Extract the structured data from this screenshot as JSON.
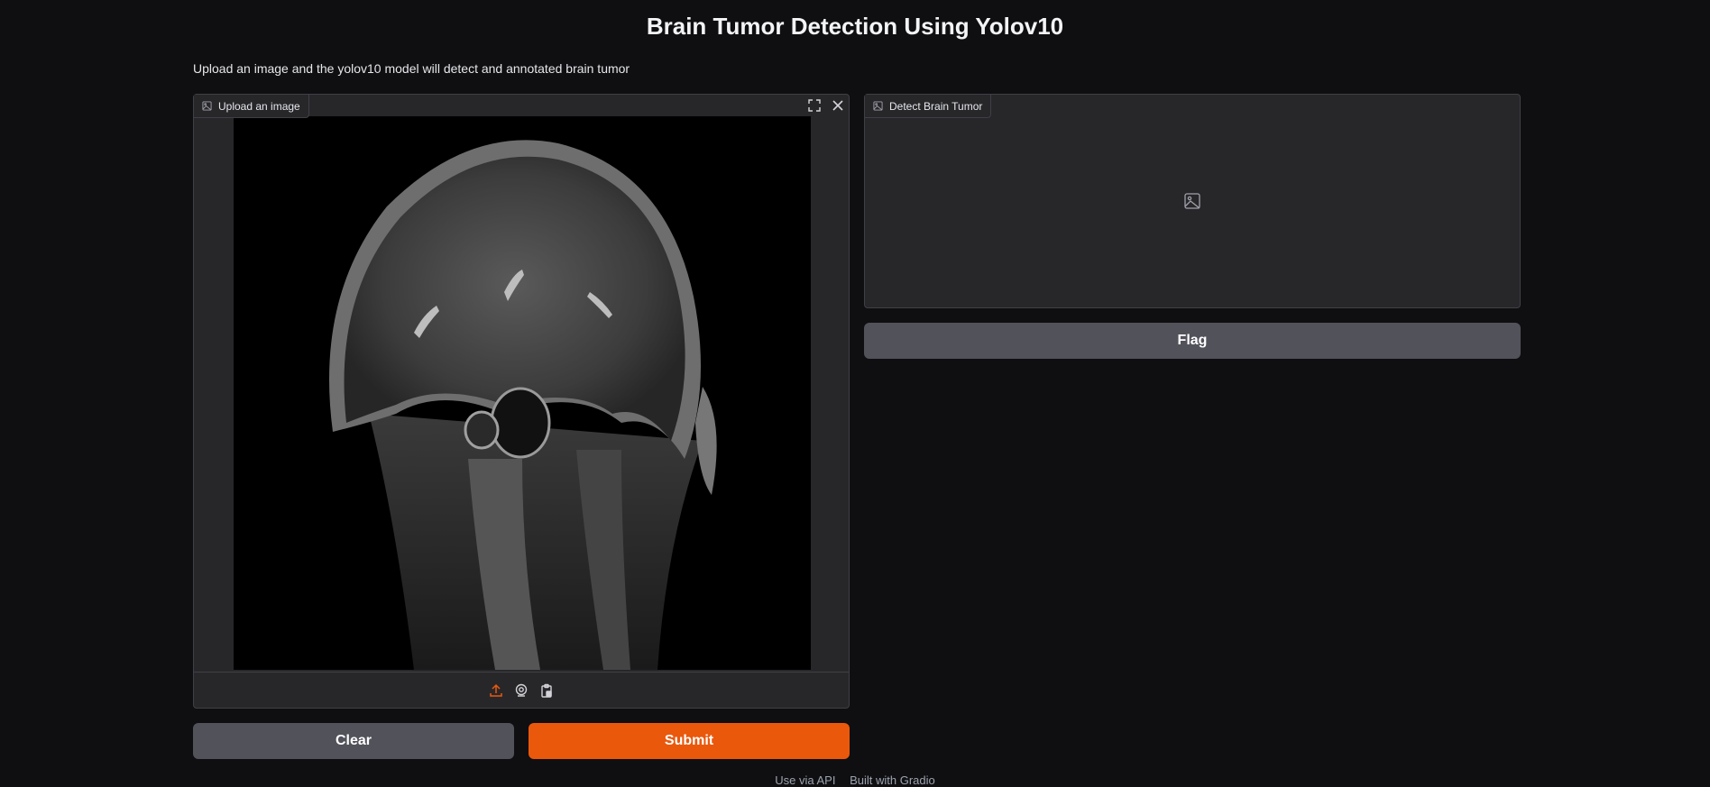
{
  "header": {
    "title": "Brain Tumor Detection Using Yolov10",
    "description": "Upload an image and the yolov10 model will detect and annotated brain tumor"
  },
  "input_panel": {
    "label": "Upload an image",
    "image_icon": "image-icon",
    "fullscreen_icon": "fullscreen-icon",
    "clear_icon": "close-icon",
    "sources": [
      "upload-icon",
      "webcam-icon",
      "clipboard-icon"
    ],
    "image_content": "sagittal brain MRI scan"
  },
  "output_panel": {
    "label": "Detect Brain Tumor",
    "placeholder_icon": "image-icon"
  },
  "buttons": {
    "clear": "Clear",
    "submit": "Submit",
    "flag": "Flag"
  },
  "footer": {
    "api": "Use via API",
    "built_with": "Built with Gradio"
  },
  "colors": {
    "background": "#0f0f11",
    "panel": "#27272a",
    "border": "#3f3f46",
    "primary": "#ea580c",
    "secondary": "#52525b"
  }
}
